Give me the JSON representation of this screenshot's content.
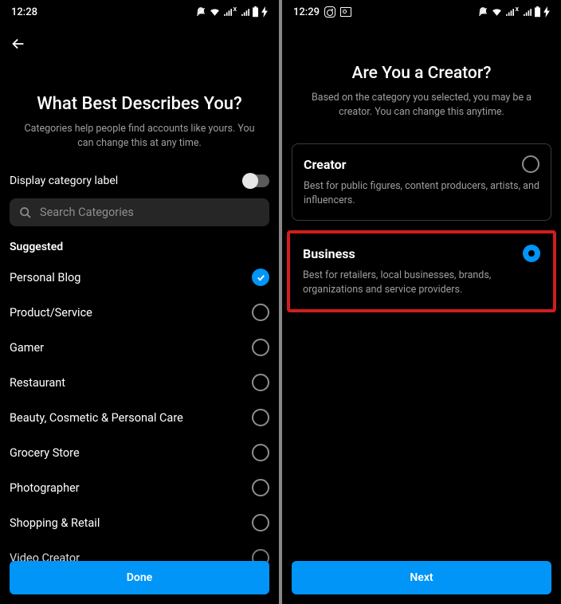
{
  "screen1": {
    "status": {
      "time": "12:28"
    },
    "title": "What Best Describes You?",
    "subtitle": "Categories help people find accounts like yours. You can change this at any time.",
    "toggle_label": "Display category label",
    "search_placeholder": "Search Categories",
    "suggested_label": "Suggested",
    "categories": [
      {
        "label": "Personal Blog",
        "selected": true
      },
      {
        "label": "Product/Service",
        "selected": false
      },
      {
        "label": "Gamer",
        "selected": false
      },
      {
        "label": "Restaurant",
        "selected": false
      },
      {
        "label": "Beauty, Cosmetic & Personal Care",
        "selected": false
      },
      {
        "label": "Grocery Store",
        "selected": false
      },
      {
        "label": "Photographer",
        "selected": false
      },
      {
        "label": "Shopping & Retail",
        "selected": false
      },
      {
        "label": "Video Creator",
        "selected": false
      }
    ],
    "done_label": "Done"
  },
  "screen2": {
    "status": {
      "time": "12:29"
    },
    "title": "Are You a Creator?",
    "subtitle": "Based on the category you selected, you may be a creator. You can change this anytime.",
    "options": {
      "creator": {
        "title": "Creator",
        "desc": "Best for public figures, content producers, artists, and influencers."
      },
      "business": {
        "title": "Business",
        "desc": "Best for retailers, local businesses, brands, organizations and service providers."
      }
    },
    "next_label": "Next"
  }
}
